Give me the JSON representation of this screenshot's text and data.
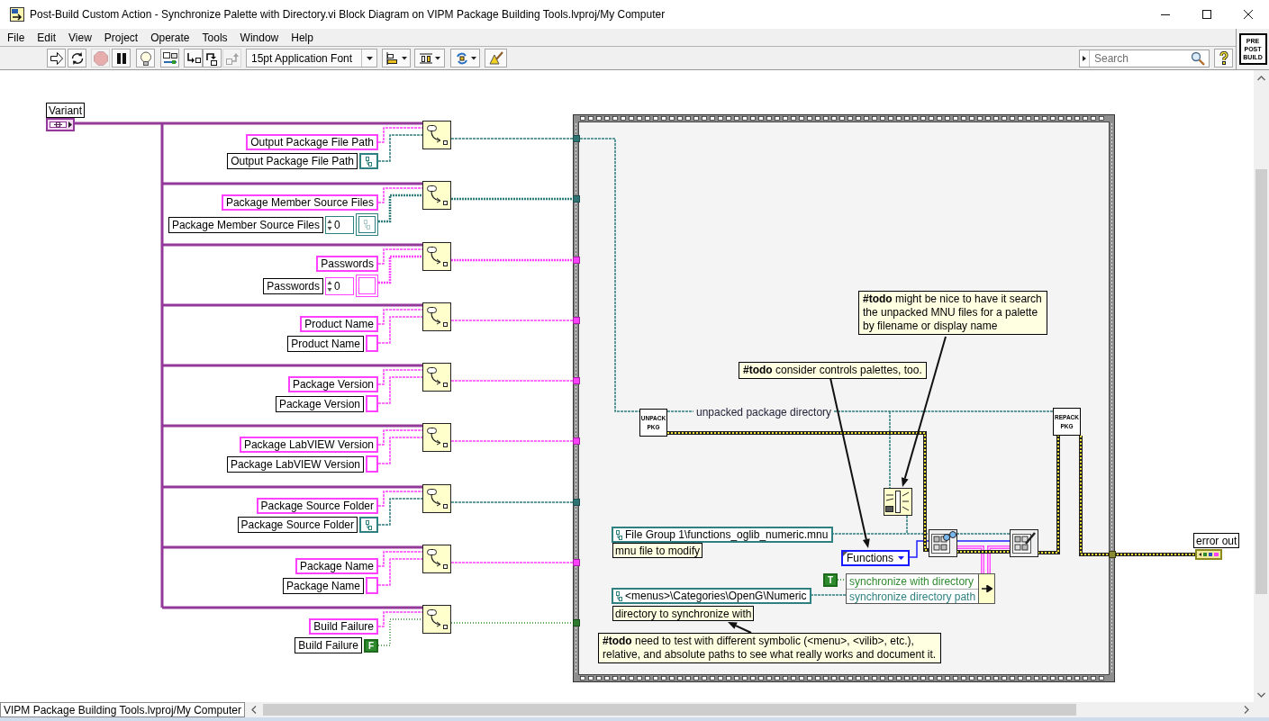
{
  "window": {
    "title": "Post-Build Custom Action - Synchronize Palette with Directory.vi Block Diagram on VIPM Package Building Tools.lvproj/My Computer"
  },
  "menu": [
    "File",
    "Edit",
    "View",
    "Project",
    "Operate",
    "Tools",
    "Window",
    "Help"
  ],
  "toolbar": {
    "buttons": [
      {
        "kind": "run",
        "disabled": false
      },
      {
        "kind": "run_continuously",
        "disabled": false
      },
      {
        "kind": "abort",
        "disabled": true
      },
      {
        "kind": "pause",
        "disabled": false
      },
      {
        "kind": "highlight",
        "disabled": false
      },
      {
        "kind": "retain",
        "disabled": false
      },
      {
        "kind": "step_into",
        "disabled": false
      },
      {
        "kind": "step_over",
        "disabled": false
      },
      {
        "kind": "step_out",
        "disabled": true
      }
    ],
    "font": "15pt Application Font",
    "search": {
      "placeholder": "Search"
    }
  },
  "vi_icon": {
    "text": "PRE POST BUILD"
  },
  "diagram": {
    "variant_control": {
      "label": "Variant"
    },
    "conversions": [
      {
        "kind": "path",
        "name": "Output Package File Path",
        "type_label": "Output Package File Path"
      },
      {
        "kind": "path_array",
        "name": "Package Member Source Files",
        "type_label": "Package Member Source Files",
        "index": "0"
      },
      {
        "kind": "string_array",
        "name": "Passwords",
        "type_label": "Passwords",
        "index": "0"
      },
      {
        "kind": "string",
        "name": "Product Name",
        "type_label": "Product Name"
      },
      {
        "kind": "string",
        "name": "Package Version",
        "type_label": "Package Version"
      },
      {
        "kind": "string",
        "name": "Package LabVIEW Version",
        "type_label": "Package LabVIEW Version"
      },
      {
        "kind": "path",
        "name": "Package Source Folder",
        "type_label": "Package Source Folder"
      },
      {
        "kind": "string",
        "name": "Package Name",
        "type_label": "Package Name"
      },
      {
        "kind": "boolean",
        "name": "Build Failure",
        "type_label": "Build Failure",
        "value": "F"
      }
    ],
    "sequence": {
      "unpack_node": {
        "text": "UNPACK PKG"
      },
      "wire_label": "unpacked package directory",
      "repack_node": {
        "text": "REPACK PKG"
      },
      "comments": [
        {
          "text": "**#todo** might be nice to have it search the unpacked MNU files for a palette by filename or display name"
        },
        {
          "text": "**#todo** consider controls palettes, too."
        },
        {
          "text": "**#todo** need to test with different symbolic (<menu>, <vilib>, etc.), relative, and absolute paths to see what really works and document it."
        }
      ],
      "mnu_path": {
        "value": "File Group 1\\functions_oglib_numeric.mnu",
        "label": "mnu file to modify"
      },
      "palette_type": {
        "value": "Functions"
      },
      "sync_flag": {
        "value": "T"
      },
      "bundle": {
        "elements": [
          {
            "kind": "boolean",
            "name": "synchronize with directory"
          },
          {
            "kind": "path",
            "name": "synchronize directory path"
          }
        ]
      },
      "directory_path": {
        "value": "<menus>\\Categories\\OpenG\\Numeric",
        "label": "directory to synchronize with"
      }
    },
    "error_out": {
      "label": "error out"
    }
  },
  "status_bar": {
    "project": "VIPM Package Building Tools.lvproj/My Computer"
  }
}
